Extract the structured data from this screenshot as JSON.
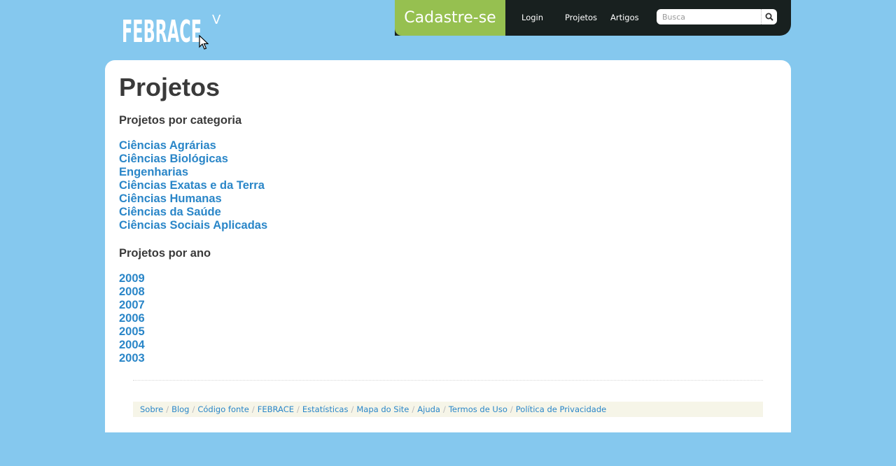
{
  "header": {
    "logo_text": "FEBRACE",
    "logo_suffix": "V",
    "signup_label": "Cadastre-se",
    "nav": [
      {
        "label": "Login"
      },
      {
        "label": "Projetos"
      },
      {
        "label": "Artigos"
      }
    ],
    "search": {
      "placeholder": "Busca",
      "value": ""
    }
  },
  "main": {
    "title": "Projetos",
    "category_heading": "Projetos por categoria",
    "categories": [
      "Ciências Agrárias",
      "Ciências Biológicas",
      "Engenharias",
      "Ciências Exatas e da Terra",
      "Ciências Humanas",
      "Ciências da Saúde",
      "Ciências Sociais Aplicadas"
    ],
    "year_heading": "Projetos por ano",
    "years": [
      "2009",
      "2008",
      "2007",
      "2006",
      "2005",
      "2004",
      "2003"
    ]
  },
  "footer": {
    "links": [
      "Sobre",
      "Blog",
      "Código fonte",
      "FEBRACE",
      "Estatísticas",
      "Mapa do Site",
      "Ajuda",
      "Termos de Uso",
      "Política de Privacidade"
    ],
    "separator": "/"
  },
  "colors": {
    "background": "#85c8ee",
    "topbar": "#18201f",
    "signup": "#96c050",
    "link": "#2a86c8",
    "heading": "#3a3a3a",
    "footer_bg": "#f6f5e8"
  }
}
